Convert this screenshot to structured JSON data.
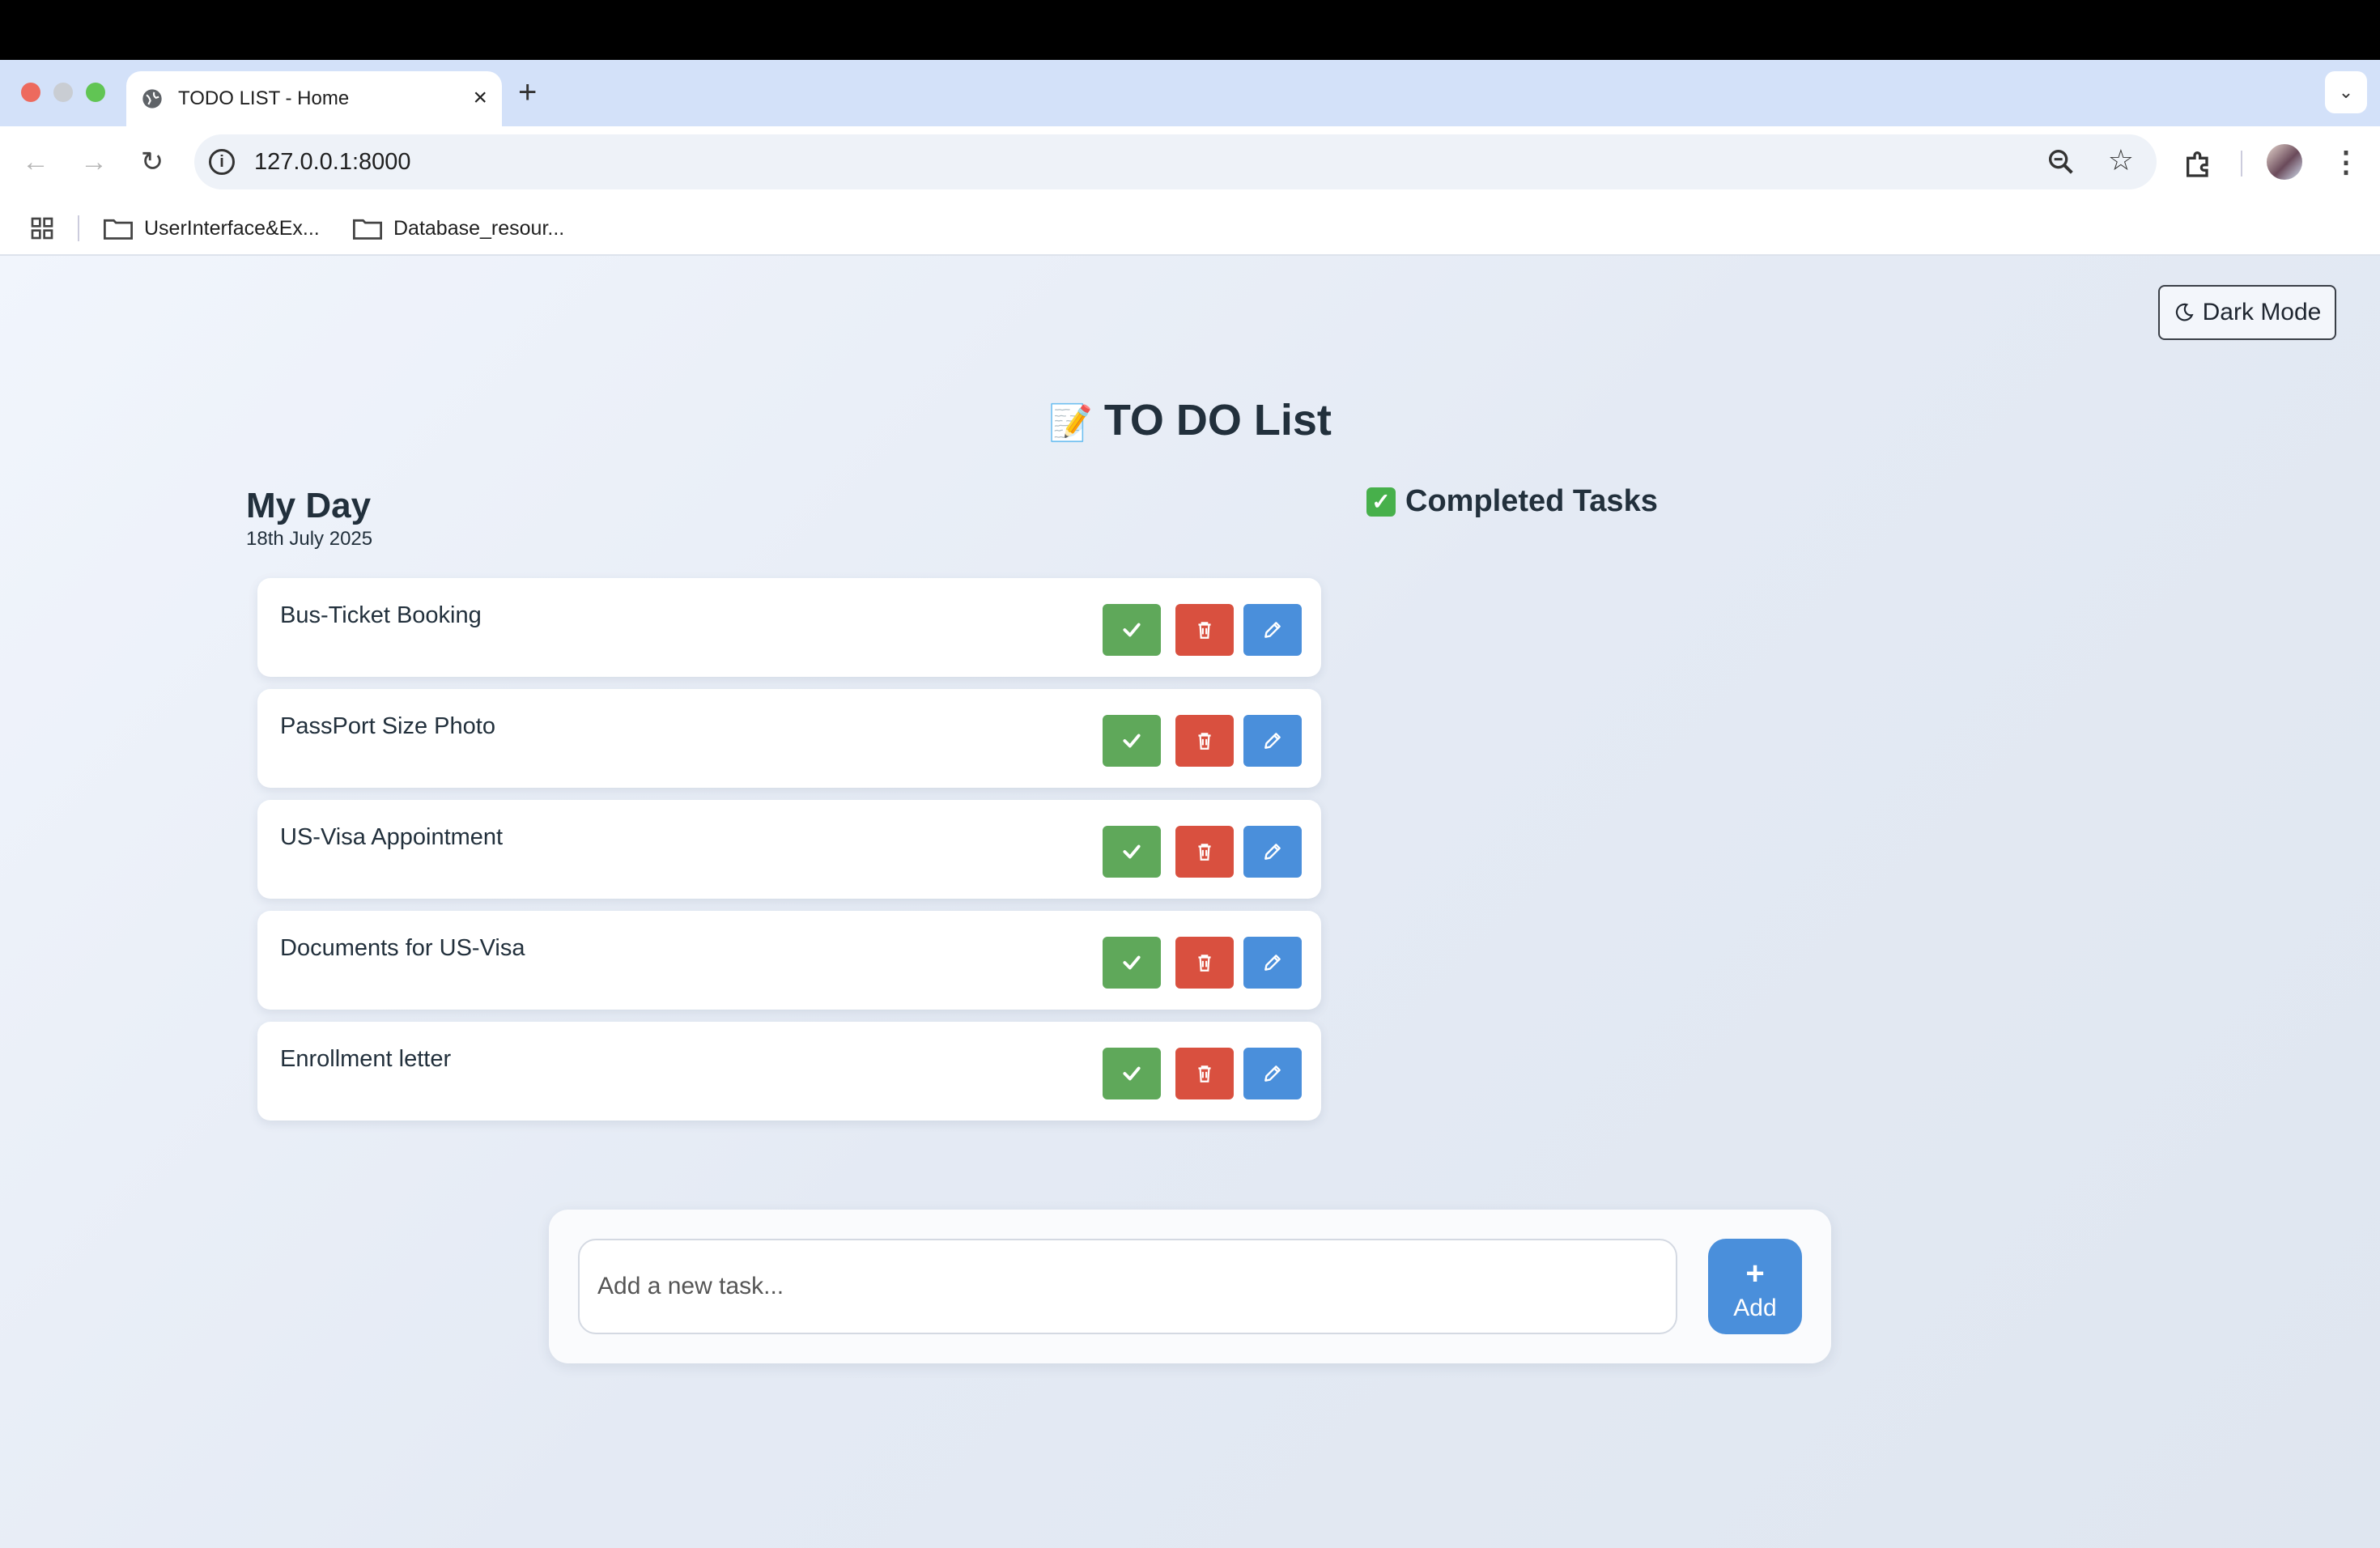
{
  "browser": {
    "tab_title": "TODO LIST - Home",
    "url": "127.0.0.1:8000",
    "bookmarks": [
      "UserInterface&Ex...",
      "Database_resour..."
    ]
  },
  "page": {
    "dark_mode_label": "Dark Mode",
    "title_emoji": "📝",
    "title": "TO DO List",
    "my_day": {
      "heading": "My Day",
      "date": "18th July 2025"
    },
    "completed": {
      "icon": "✓",
      "heading": "Completed Tasks"
    },
    "tasks": [
      "Bus-Ticket Booking",
      "PassPort Size Photo",
      "US-Visa Appointment",
      "Documents for US-Visa",
      "Enrollment letter"
    ],
    "add_task": {
      "placeholder": "Add a new task...",
      "button_icon": "+",
      "button_label": "Add"
    }
  },
  "colors": {
    "complete_button": "#5fa85a",
    "delete_button": "#d9503f",
    "edit_button": "#4a8fdb",
    "add_button": "#4a8fdb",
    "text": "#22303c"
  }
}
